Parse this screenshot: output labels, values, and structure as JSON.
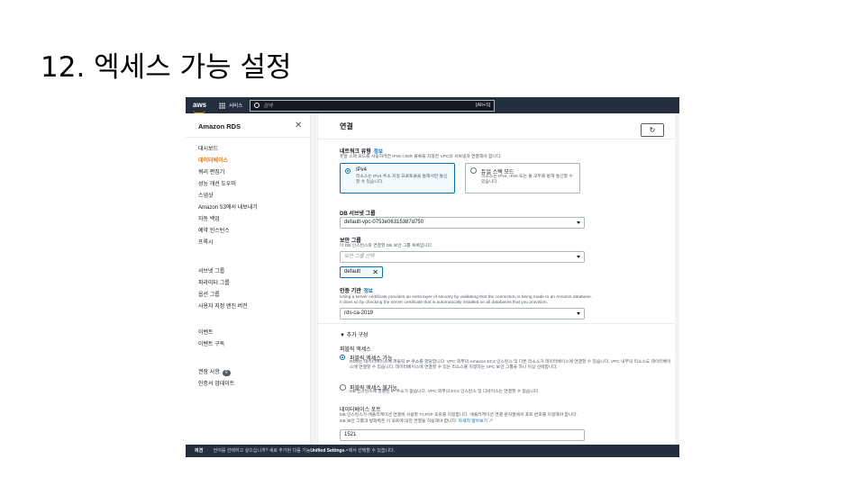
{
  "slide": {
    "title": "12. 엑세스 가능 설정"
  },
  "topnav": {
    "logo": "aws",
    "services": "서비스",
    "search_placeholder": "검색",
    "shortcut": "[Alt+S]"
  },
  "sidebar": {
    "title": "Amazon RDS",
    "group1": [
      "대시보드",
      "데이터베이스",
      "쿼리 편집기",
      "성능 개선 도우미",
      "스냅샷",
      "Amazon S3에서 내보내기",
      "자동 백업",
      "예약 인스턴스",
      "프록시"
    ],
    "active_item": "데이터베이스",
    "group2": [
      "서브넷 그룹",
      "파라미터 그룹",
      "옵션 그룹",
      "사용자 지정 엔진 버전"
    ],
    "group3": [
      "이벤트",
      "이벤트 구독"
    ],
    "recommendations_label": "권장 사항",
    "recommendations_count": "0",
    "certificate_update": "인증서 업데이트"
  },
  "main": {
    "section_title": "연결",
    "network_type": {
      "label": "네트워크 유형",
      "info": "정보",
      "desc": "듀얼 스택 모드를 사용하려면 IPv6 CIDR 블록을 지정한 VPC의 서브넷과 연결해야 합니다.",
      "ipv4_title": "IPv4",
      "ipv4_desc": "리소스는 IPv4 주소 지정 프로토콜을 통해서만 통신할 수 있습니다.",
      "dual_title": "듀얼 스택 모드",
      "dual_desc": "리소스는 IPv4, IPv6 또는 둘 모두를 통해 통신할 수 있습니다."
    },
    "subnet_group": {
      "label": "DB 서브넷 그룹",
      "value": "default-vpc-0753e06315387d750"
    },
    "security_group": {
      "label": "보안 그룹",
      "desc": "이 DB 인스턴스와 연결할 DB 보안 그룹 목록입니다.",
      "placeholder": "보안 그룹 선택",
      "token": "default"
    },
    "certificate_authority": {
      "label": "인증 기관",
      "info": "정보",
      "desc1": "Using a server certificate provides an extra layer of security by validating that the connection is being made to an Amazon database.",
      "desc2": "It does so by checking the server certificate that is automatically installed on all databases that you provision.",
      "value": "rds-ca-2019"
    },
    "additional": {
      "toggle": "추가 구성",
      "public_access_label": "퍼블릭 액세스",
      "public_yes_title": "퍼블릭 액세스 가능",
      "public_yes_desc": "RDS는 데이터베이스에 퍼블릭 IP 주소를 할당합니다. VPC 외부의 Amazon EC2 인스턴스 및 다른 리소스가 데이터베이스에 연결할 수 있습니다. VPC 내부의 리소스도 데이터베이스에 연결할 수 있습니다. 데이터베이스에 연결할 수 있는 리소스를 지정하는 VPC 보안 그룹을 하나 이상 선택합니다.",
      "public_no_title": "퍼블릭 액세스 불가능",
      "public_no_desc": "DB 인스턴스에 할당된 IP 주소가 없습니다. VPC 외부의 EC2 인스턴스 및 디바이스는 연결할 수 없습니다.",
      "port_label": "데이터베이스 포트",
      "port_desc1": "DB 인스턴스가 애플리케이션 연결에 사용할 TCP/IP 포트를 지정합니다. 애플리케이션 연결 문자열에서 포트 번호를 지정해야 합니다.",
      "port_desc2": "DB 보안 그룹과 방화벽은 이 포트에 대한 연결을 허용해야 합니다.",
      "learn_more": "자세히 알아보기",
      "port_value": "1521"
    }
  },
  "footer": {
    "feedback": "의견",
    "text": "언어를 선택하고 싶으십니까? 새로 추가된 다음 기능",
    "unified": "Unified Settings",
    "text2": "에서 선택할 수 있습니다."
  },
  "colors": {
    "accent": "#ec7211",
    "link": "#0073bb",
    "nav_bg": "#232f3e"
  }
}
